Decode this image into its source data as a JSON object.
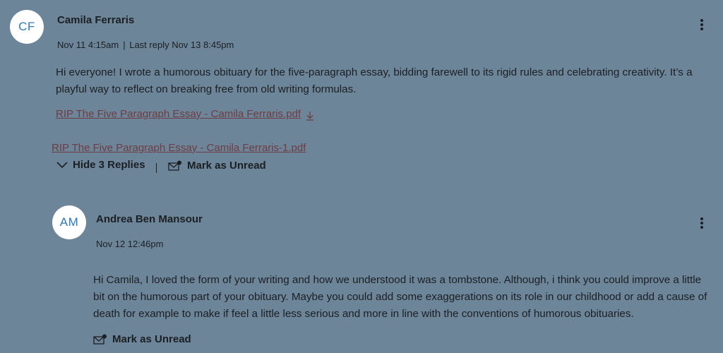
{
  "post": {
    "avatar_initials": "CF",
    "author": "Camila Ferraris",
    "posted": "Nov 11 4:15am",
    "last_reply": "Last reply Nov 13 8:45pm",
    "body": "Hi everyone! I wrote a humorous obituary for the five-paragraph essay, bidding farewell to its rigid rules and celebrating creativity. It’s a playful way to reflect on breaking free from old writing formulas.",
    "attachment_1": "RIP The Five Paragraph Essay - Camila Ferraris.pdf",
    "attachment_2": "RIP The Five Paragraph Essay - Camila Ferraris-1.pdf",
    "hide_replies_label": "Hide 3 Replies",
    "mark_unread_label": "Mark as Unread"
  },
  "reply": {
    "avatar_initials": "AM",
    "author": "Andrea Ben Mansour",
    "posted": "Nov 12 12:46pm",
    "body": "Hi Camila, I loved the form of your writing and how we understood it was a tombstone. Although, i think you could improve a little bit on the humorous part of your obituary. Maybe you could add some exaggerations on its role in our childhood or add a cause of death for example to make if feel a little less serious and more in line with the conventions of humorous obituaries.",
    "mark_unread_label": "Mark as Unread"
  },
  "icons": {
    "kebab": "more-options-icon",
    "download": "download-icon",
    "chevron": "chevron-down-icon",
    "mail": "mail-unread-icon"
  },
  "colors": {
    "background": "#6d8599",
    "avatar_text": "#2b7abc",
    "link": "#6e3c43",
    "text": "#1b1f23"
  }
}
